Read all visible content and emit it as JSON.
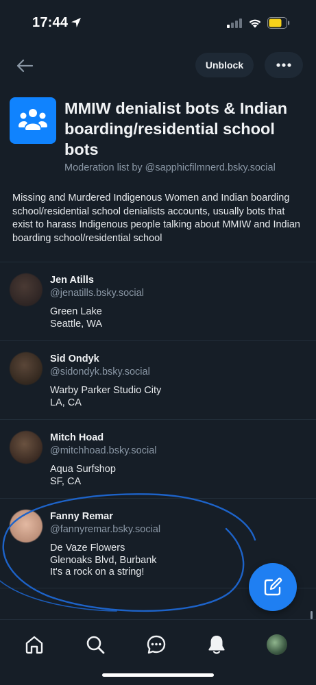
{
  "status_bar": {
    "time": "17:44",
    "icons": [
      "location-arrow-icon",
      "cellular-signal-icon",
      "wifi-icon",
      "battery-icon"
    ],
    "battery_color": "#f8d21a"
  },
  "header": {
    "back_icon": "arrow-left-icon",
    "unblock_label": "Unblock",
    "more_icon": "ellipsis-icon"
  },
  "list": {
    "avatar_icon": "group-icon",
    "avatar_color": "#1083fe",
    "title": "MMIW denialist bots & Indian boarding/residential school bots",
    "subtitle": "Moderation list by @sapphicfilmnerd.bsky.social",
    "description": "Missing and Murdered Indigenous Women and Indian boarding school/residential school denialists accounts, usually bots that exist to harass Indigenous people talking about MMIW and Indian boarding school/residential school"
  },
  "members": [
    {
      "name": "Jen Atills",
      "handle": "@jenatills.bsky.social",
      "bio": [
        "Green Lake",
        "Seattle, WA"
      ]
    },
    {
      "name": "Sid Ondyk",
      "handle": "@sidondyk.bsky.social",
      "bio": [
        "Warby Parker Studio City",
        "LA, CA"
      ]
    },
    {
      "name": "Mitch Hoad",
      "handle": "@mitchhoad.bsky.social",
      "bio": [
        "Aqua Surfshop",
        "SF, CA"
      ]
    },
    {
      "name": "Fanny Remar",
      "handle": "@fannyremar.bsky.social",
      "bio": [
        "De Vaze Flowers",
        "Glenoaks Blvd, Burbank",
        "It's a rock on a string!"
      ]
    }
  ],
  "fab": {
    "icon": "compose-icon",
    "color": "#1f7ff2"
  },
  "bottom_nav": {
    "items": [
      "home-icon",
      "search-icon",
      "chat-icon",
      "notifications-bell-icon",
      "profile-avatar"
    ]
  },
  "accent_color": "#1083fe",
  "annotation_color": "#1d63c9"
}
